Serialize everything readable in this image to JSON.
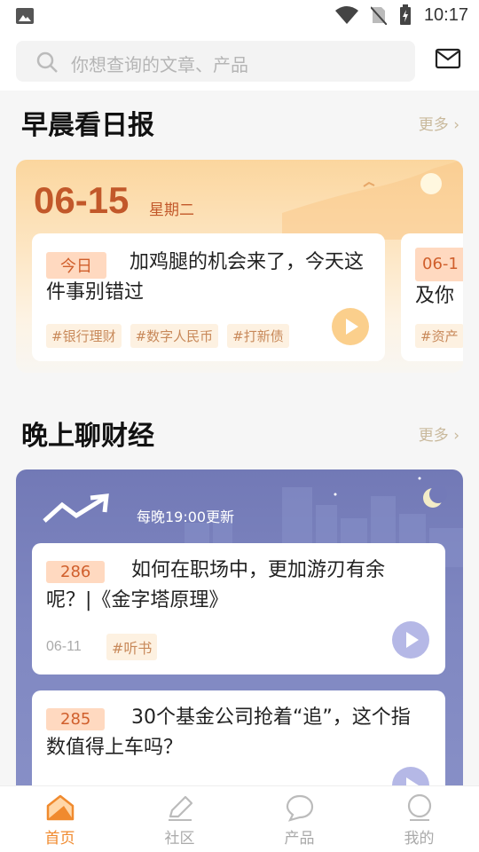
{
  "status_bar": {
    "time": "10:17"
  },
  "search": {
    "placeholder": "你想查询的文章、产品"
  },
  "morning": {
    "title": "早晨看日报",
    "more": "更多 ›",
    "date": "06-15",
    "weekday": "星期二",
    "cards": [
      {
        "tag": "今日",
        "title": "加鸡腿的机会来了，今天这件事别错过",
        "hashtags": [
          "#银行理财",
          "#数字人民币",
          "#打新债"
        ]
      },
      {
        "tag": "06-1",
        "title": "及你",
        "hashtags": [
          "#资产"
        ]
      }
    ]
  },
  "evening": {
    "title": "晚上聊财经",
    "more": "更多 ›",
    "update_note": "每晚19:00更新",
    "episodes": [
      {
        "number": "286",
        "title": "如何在职场中，更加游刃有余呢？|《金字塔原理》",
        "date": "06-11",
        "tag": "#听书"
      },
      {
        "number": "285",
        "title": "30个基金公司抢着“追”，这个指数值得上车吗？"
      }
    ]
  },
  "tabs": [
    {
      "label": "首页",
      "icon": "home-icon",
      "active": true
    },
    {
      "label": "社区",
      "icon": "pencil-icon",
      "active": false
    },
    {
      "label": "产品",
      "icon": "chat-bubble-icon",
      "active": false
    },
    {
      "label": "我的",
      "icon": "person-icon",
      "active": false
    }
  ],
  "colors": {
    "accent": "#f08a2e",
    "date": "#c2582a",
    "night_bg": "#7a81bd"
  }
}
